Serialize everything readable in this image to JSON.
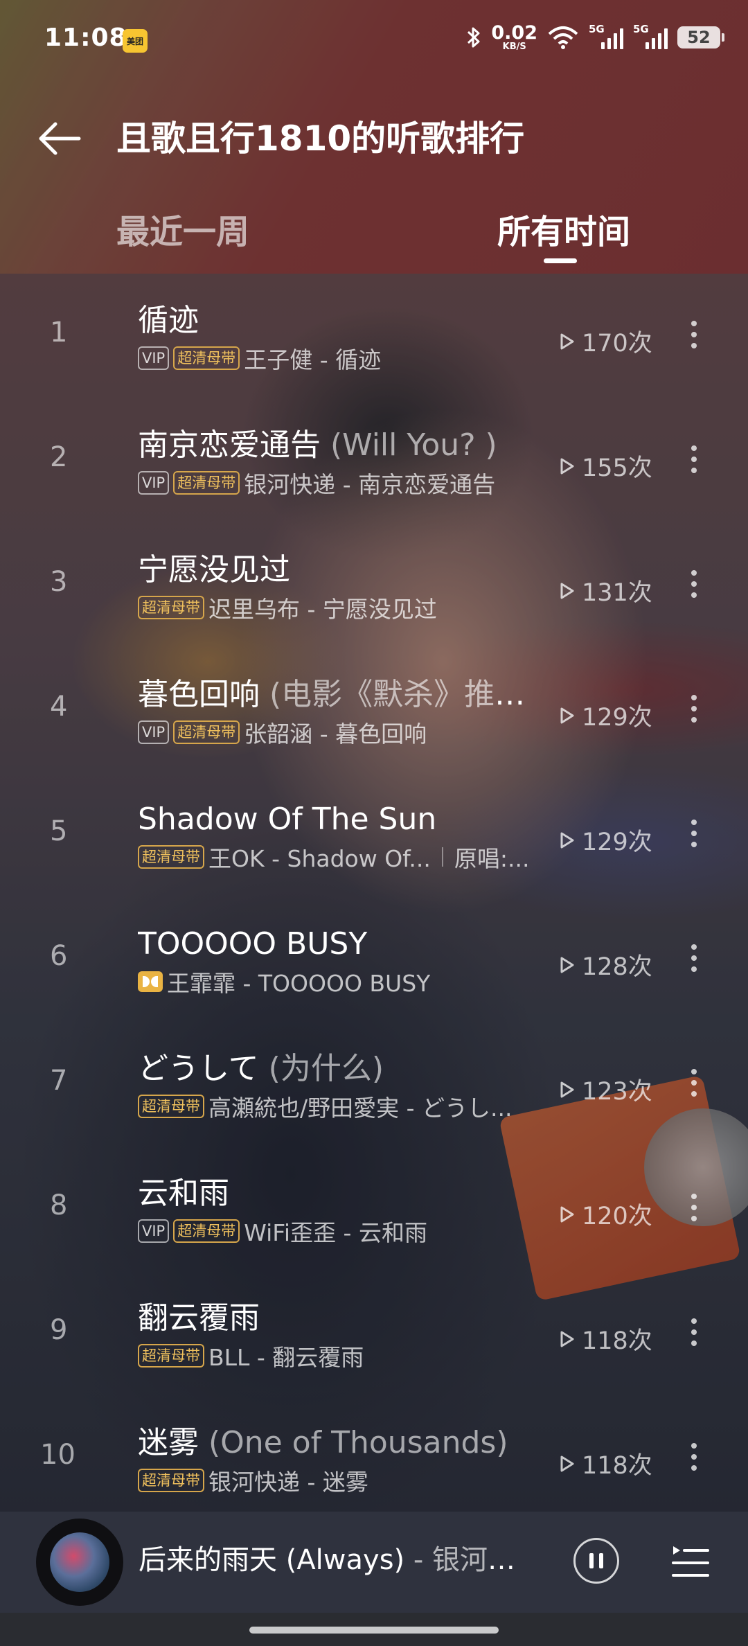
{
  "status_bar": {
    "time": "11:08",
    "app_badge": "美团",
    "net_speed_value": "0.02",
    "net_speed_unit": "KB/S",
    "sim1": "5G",
    "sim2": "5G",
    "battery": "52"
  },
  "header": {
    "title": "且歌且行1810的听歌排行"
  },
  "tabs": [
    {
      "label": "最近一周",
      "selected": false
    },
    {
      "label": "所有时间",
      "selected": true
    }
  ],
  "badges": {
    "vip": "VIP",
    "hd": "超清母带"
  },
  "songs": [
    {
      "rank": "1",
      "title": "循迹",
      "subtitle": "",
      "vip": true,
      "hd": true,
      "dolby": false,
      "meta": "王子健 - 循迹",
      "extra": "",
      "plays": "170次"
    },
    {
      "rank": "2",
      "title": "南京恋爱通告",
      "subtitle": " (Will You? )",
      "vip": true,
      "hd": true,
      "dolby": false,
      "meta": "银河快递 - 南京恋爱通告",
      "extra": "",
      "plays": "155次"
    },
    {
      "rank": "3",
      "title": "宁愿没见过",
      "subtitle": "",
      "vip": false,
      "hd": true,
      "dolby": false,
      "meta": "迟里乌布 - 宁愿没见过",
      "extra": "",
      "plays": "131次"
    },
    {
      "rank": "4",
      "title": "暮色回响",
      "subtitle": " (电影《默杀》推广…",
      "vip": true,
      "hd": true,
      "dolby": false,
      "meta": "张韶涵 - 暮色回响",
      "extra": "",
      "plays": "129次"
    },
    {
      "rank": "5",
      "title": "Shadow Of The Sun",
      "subtitle": "",
      "vip": false,
      "hd": true,
      "dolby": false,
      "meta": "王OK - Shadow Of...",
      "extra": "原唱:...",
      "plays": "129次"
    },
    {
      "rank": "6",
      "title": "TOOOOO BUSY",
      "subtitle": "",
      "vip": false,
      "hd": false,
      "dolby": true,
      "meta": "王霏霏 - TOOOOO BUSY",
      "extra": "",
      "plays": "128次"
    },
    {
      "rank": "7",
      "title": "どうして",
      "subtitle": " (为什么)",
      "vip": false,
      "hd": true,
      "dolby": false,
      "meta": "高瀬統也/野田愛実 - どうし...",
      "extra": "",
      "plays": "123次"
    },
    {
      "rank": "8",
      "title": "云和雨",
      "subtitle": "",
      "vip": true,
      "hd": true,
      "dolby": false,
      "meta": "WiFi歪歪 - 云和雨",
      "extra": "",
      "plays": "120次"
    },
    {
      "rank": "9",
      "title": "翻云覆雨",
      "subtitle": "",
      "vip": false,
      "hd": true,
      "dolby": false,
      "meta": "BLL - 翻云覆雨",
      "extra": "",
      "plays": "118次"
    },
    {
      "rank": "10",
      "title": "迷雾",
      "subtitle": " (One of Thousands)",
      "vip": false,
      "hd": true,
      "dolby": false,
      "meta": "银河快递 - 迷雾",
      "extra": "",
      "plays": "118次"
    }
  ],
  "player": {
    "title": "后来的雨天 (Always)",
    "artist": " - 银河快..."
  },
  "icons": {
    "back": "arrow-left-icon",
    "play": "play-triangle-icon",
    "more": "more-vertical-icon",
    "pause": "pause-icon",
    "playlist": "playlist-icon"
  },
  "colors": {
    "hd_badge": "#f0c15d",
    "dolby_badge": "#e9b343",
    "header_bg": "#8a3b3c"
  }
}
